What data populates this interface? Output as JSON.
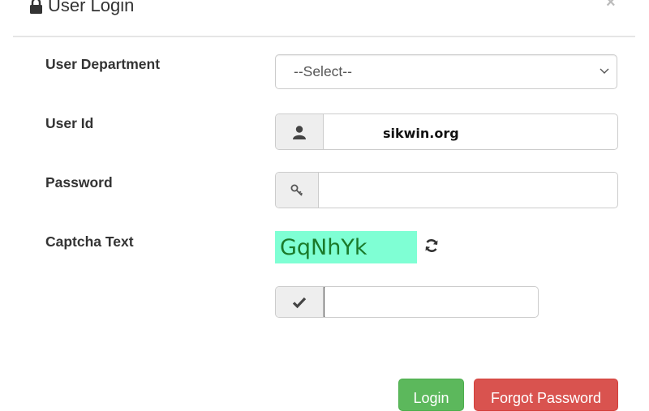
{
  "modal": {
    "title": "User Login",
    "close_label": "×"
  },
  "form": {
    "department": {
      "label": "User Department",
      "selected": "--Select--"
    },
    "user_id": {
      "label": "User Id",
      "value": "sikwin.org"
    },
    "password": {
      "label": "Password",
      "value": ""
    },
    "captcha": {
      "label": "Captcha Text",
      "code": "GqNhYk",
      "input_value": ""
    }
  },
  "buttons": {
    "login": "Login",
    "forgot": "Forgot Password"
  },
  "colors": {
    "login": "#5cb85c",
    "forgot": "#d9534f",
    "captcha_bg": "#7fffd4",
    "captcha_text": "#1a7a2a"
  }
}
